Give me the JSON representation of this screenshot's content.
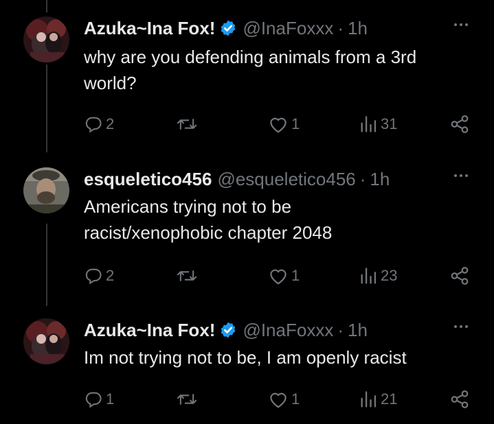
{
  "tweets": [
    {
      "author_name": "Azuka~Ina Fox!",
      "verified": true,
      "handle": "@InaFoxxx",
      "separator": "·",
      "time": "1h",
      "text": "why are you defending animals from a 3rd world?",
      "replies": "2",
      "retweets": "",
      "likes": "1",
      "views": "31"
    },
    {
      "author_name": "esqueletico456",
      "verified": false,
      "handle": "@esqueletico456",
      "separator": "·",
      "time": "1h",
      "text": "Americans trying not to be racist/xenophobic chapter 2048",
      "replies": "2",
      "retweets": "",
      "likes": "1",
      "views": "23"
    },
    {
      "author_name": "Azuka~Ina Fox!",
      "verified": true,
      "handle": "@InaFoxxx",
      "separator": "·",
      "time": "1h",
      "text": "Im not trying not to be, I am openly racist",
      "replies": "1",
      "retweets": "",
      "likes": "1",
      "views": "21"
    }
  ],
  "colors": {
    "background": "#000000",
    "text": "#e7e9ea",
    "muted": "#71767b",
    "verified": "#1d9bf0",
    "thread_line": "#333639"
  },
  "icons": [
    "reply-icon",
    "retweet-icon",
    "like-icon",
    "views-icon",
    "share-icon",
    "more-icon",
    "verified-badge-icon"
  ]
}
